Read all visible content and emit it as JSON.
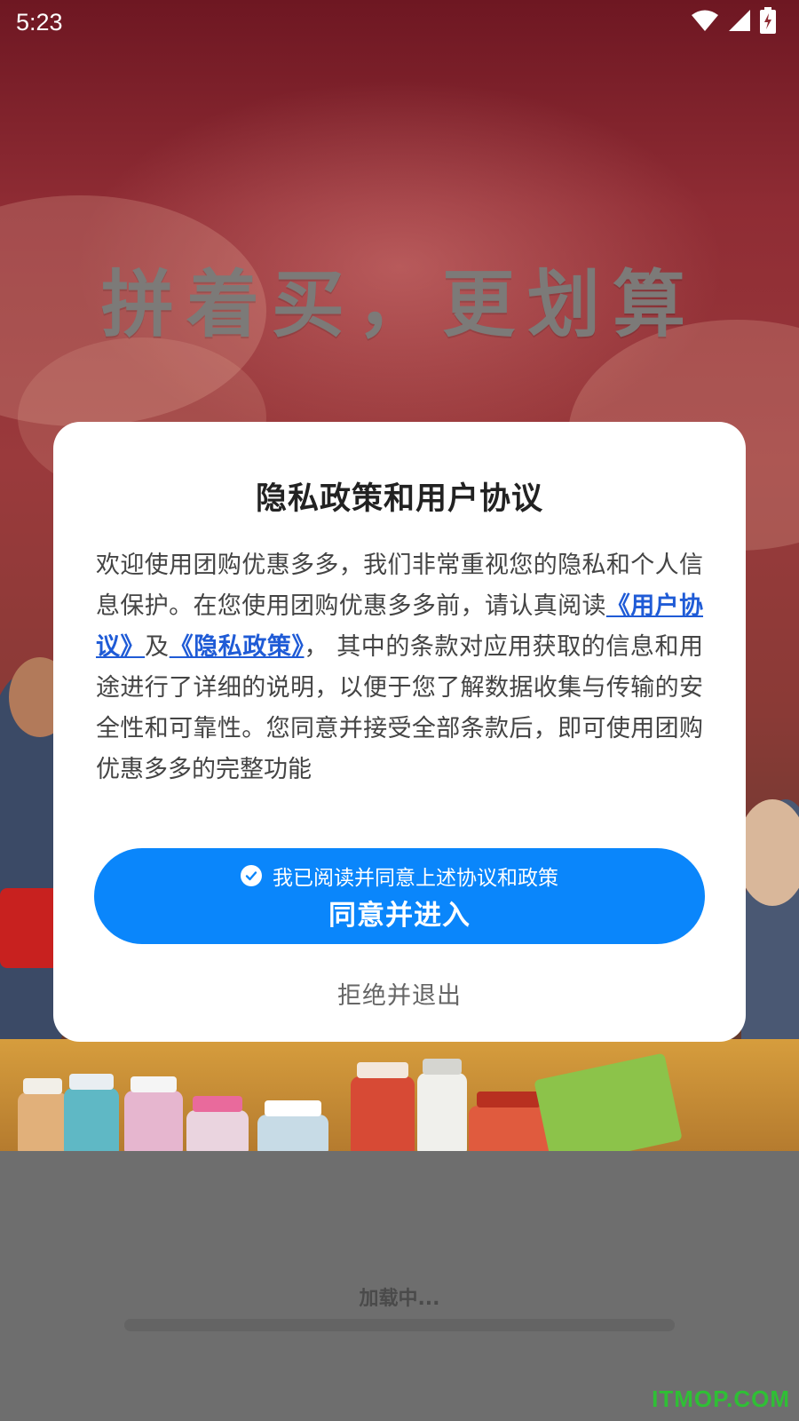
{
  "status_bar": {
    "time": "5:23",
    "icons": [
      "wifi-icon",
      "signal-icon",
      "battery-charging-icon"
    ]
  },
  "splash": {
    "slogan": "拼着买，更划算"
  },
  "dialog": {
    "title": "隐私政策和用户协议",
    "body": {
      "intro": "欢迎使用团购优惠多多，我们非常重视您的隐私和个人信息保护。在您使用团购优惠多多前，请认真阅读",
      "user_agreement_link": "《用户协议》",
      "and": "及",
      "privacy_policy_link": "《隐私政策》",
      "rest": "， 其中的条款对应用获取的信息和用途进行了详细的说明，以便于您了解数据收集与传输的安全性和可靠性。您同意并接受全部条款后，即可使用团购优惠多多的完整功能"
    },
    "checkbox_label": "我已阅读并同意上述协议和政策",
    "checkbox_checked": true,
    "agree_button_label": "同意并进入",
    "reject_button_label": "拒绝并退出"
  },
  "loading": {
    "text": "加载中...",
    "progress": 0.0
  },
  "watermark": "ITMOP.COM",
  "colors": {
    "accent": "#0a86fb",
    "link": "#1f5bd6",
    "splash_red": "#8f2c34",
    "watermark": "#2fbf35"
  }
}
